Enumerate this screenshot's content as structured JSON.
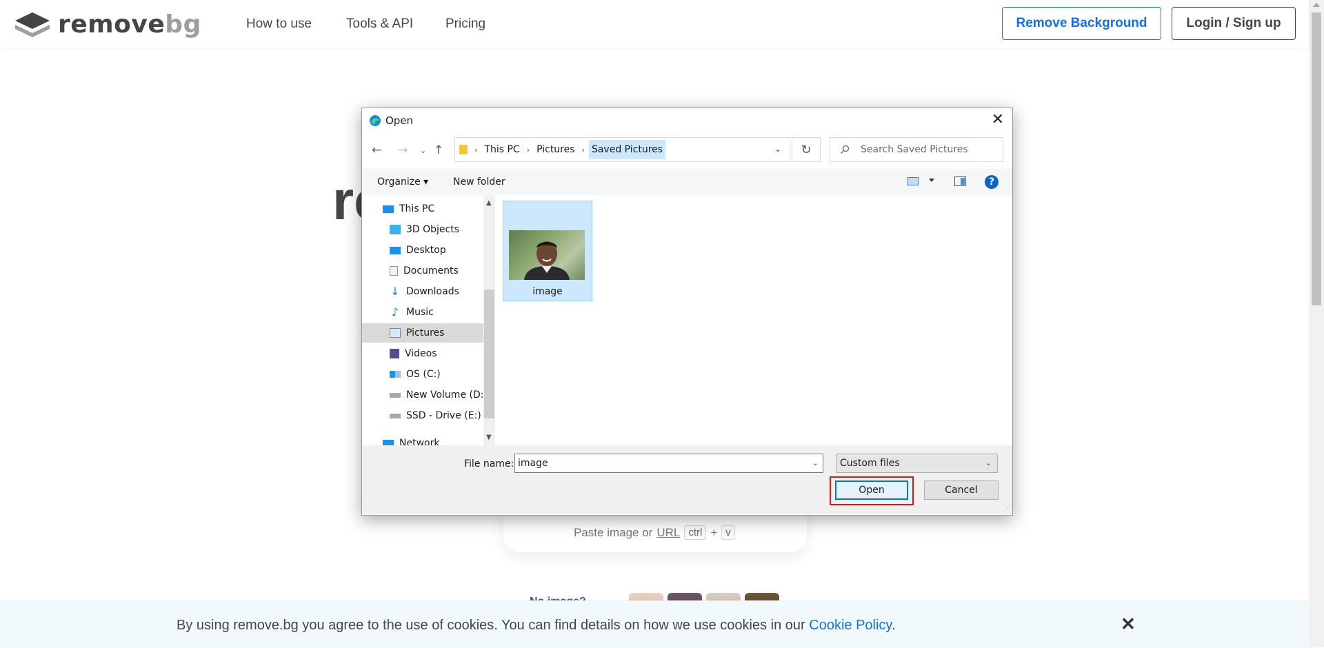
{
  "site": {
    "logo": {
      "part1": "remove",
      "part2": "bg"
    },
    "nav": [
      {
        "label": "How to use"
      },
      {
        "label": "Tools & API"
      },
      {
        "label": "Pricing"
      }
    ],
    "remove_background_label": "Remove Background",
    "login_label": "Login / Sign up"
  },
  "page": {
    "hero_partial": "re",
    "paste_prefix": "Paste image or",
    "paste_url": "URL",
    "kbd_ctrl": "ctrl",
    "kbd_plus": "+",
    "kbd_v": "v",
    "no_image": "No image?"
  },
  "cookie": {
    "text": "By using remove.bg you agree to the use of cookies. You can find details on how we use cookies in our",
    "link": "Cookie Policy",
    "period": ".",
    "close": "✕"
  },
  "dialog": {
    "title": "Open",
    "breadcrumbs": [
      "This PC",
      "Pictures",
      "Saved Pictures"
    ],
    "search_placeholder": "Search Saved Pictures",
    "toolbar": {
      "organize": "Organize ▾",
      "new_folder": "New folder",
      "help": "?"
    },
    "tree": [
      {
        "label": "This PC"
      },
      {
        "label": "3D Objects"
      },
      {
        "label": "Desktop"
      },
      {
        "label": "Documents"
      },
      {
        "label": "Downloads"
      },
      {
        "label": "Music"
      },
      {
        "label": "Pictures"
      },
      {
        "label": "Videos"
      },
      {
        "label": "OS (C:)"
      },
      {
        "label": "New Volume (D:)"
      },
      {
        "label": "SSD - Drive (E:)"
      },
      {
        "label": "Network"
      }
    ],
    "selected_tree_item": "Pictures",
    "files": [
      {
        "name": "image",
        "selected": true
      }
    ],
    "file_name_label": "File name:",
    "file_name_value": "image",
    "file_type": "Custom files",
    "open_label": "Open",
    "cancel_label": "Cancel"
  },
  "colors": {
    "accent": "#0f70e6",
    "selection": "#cce8ff",
    "highlight_box": "#e0161b"
  }
}
